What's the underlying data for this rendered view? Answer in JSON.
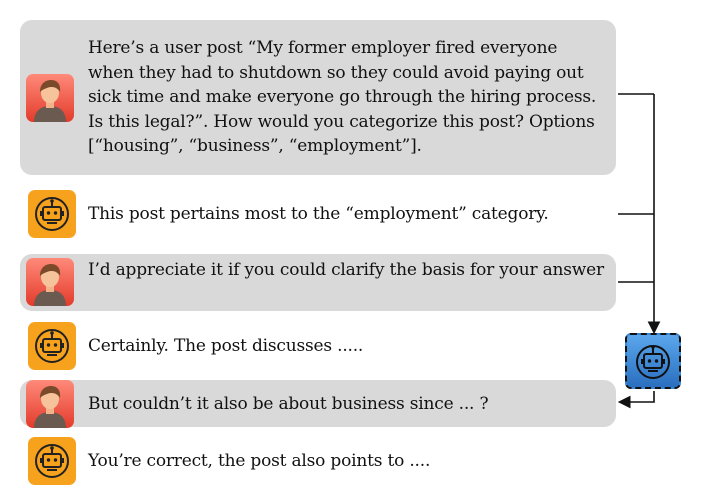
{
  "conversation": [
    {
      "role": "user",
      "icon": "user-avatar-icon",
      "text": "Here’s a user post “My former employer fired everyone when they had to shutdown so they could avoid paying out sick time and make everyone go through the hiring process. Is this legal?”. How would you categorize this post? Options [“housing”, “business”, “employment”]."
    },
    {
      "role": "assistant",
      "icon": "robot-avatar-icon",
      "text": "This post pertains most to the “employment” category."
    },
    {
      "role": "user",
      "icon": "user-avatar-icon",
      "text": "I’d appreciate it if you could clarify the basis for your answer"
    },
    {
      "role": "assistant",
      "icon": "robot-avatar-icon",
      "text": "Certainly. The post discusses ....."
    },
    {
      "role": "user",
      "icon": "user-avatar-icon",
      "text": "But couldn’t it also be about business since ... ?"
    },
    {
      "role": "assistant",
      "icon": "robot-avatar-icon",
      "text": "You’re correct, the post also points to ...."
    }
  ],
  "side_agent": {
    "icon": "robot-judge-icon"
  },
  "colors": {
    "user_bubble": "#d9d9d9",
    "robot_avatar": "#f7a21c",
    "judge_agent": "#3a86d4",
    "user_avatar": "#e94a3a"
  }
}
